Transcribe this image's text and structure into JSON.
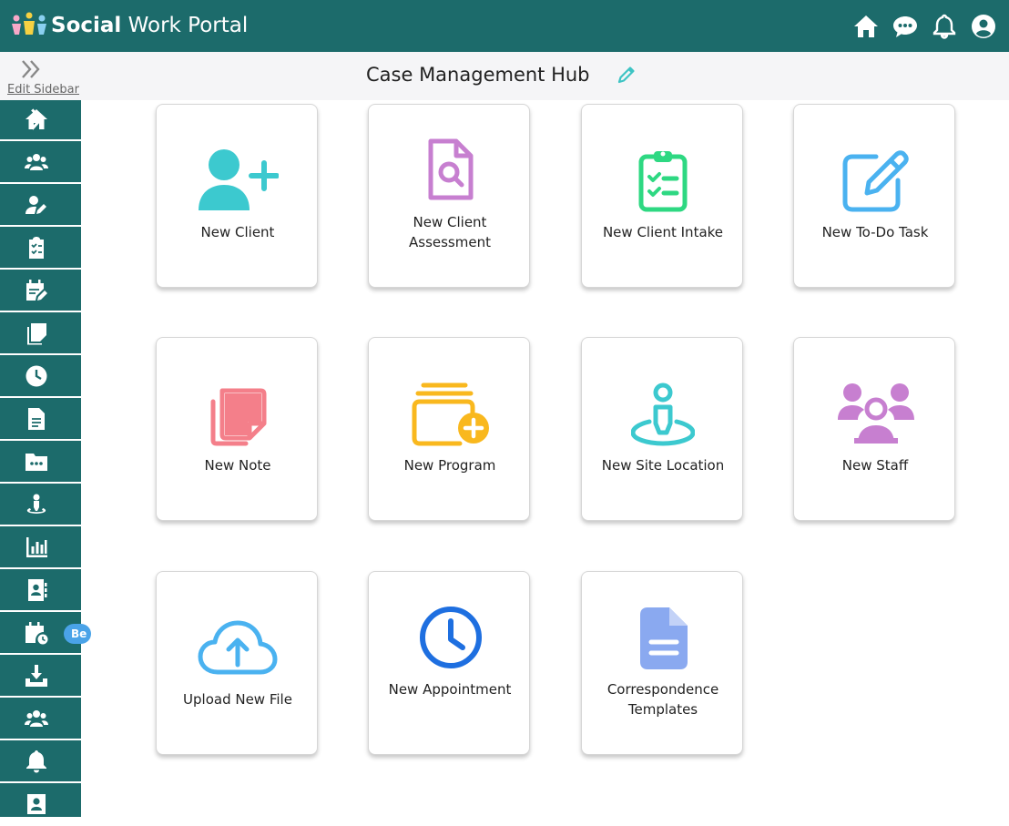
{
  "header": {
    "brand_bold": "Social",
    "brand_light": " Work Portal",
    "icons": [
      "home-icon",
      "chat-icon",
      "bell-icon",
      "user-circle-icon"
    ],
    "colors": {
      "bar": "#1c6b6b",
      "icons": "#ffffff"
    }
  },
  "subbar": {
    "edit_sidebar_label": "Edit Sidebar",
    "page_title": "Case Management Hub"
  },
  "sidebar": {
    "items": [
      "home-icon",
      "users-icon",
      "user-edit-icon",
      "clipboard-check-icon",
      "calendar-edit-icon",
      "notes-stack-icon",
      "clock-icon",
      "document-icon",
      "folder-more-icon",
      "location-pin-icon",
      "bar-chart-icon",
      "contact-book-icon",
      "calendar-clock-icon",
      "download-icon",
      "group-icon",
      "bell-icon",
      "id-badge-icon"
    ],
    "badge_text": "Be"
  },
  "cards": {
    "new_client": "New Client",
    "new_client_assessment": "New Client Assessment",
    "new_client_intake": "New Client Intake",
    "new_todo_task": "New To-Do Task",
    "new_note": "New Note",
    "new_program": "New Program",
    "new_site_location": "New Site Location",
    "new_staff": "New Staff",
    "upload_new_file": "Upload New File",
    "new_appointment": "New Appointment",
    "correspondence_templates": "Correspondence Templates"
  }
}
